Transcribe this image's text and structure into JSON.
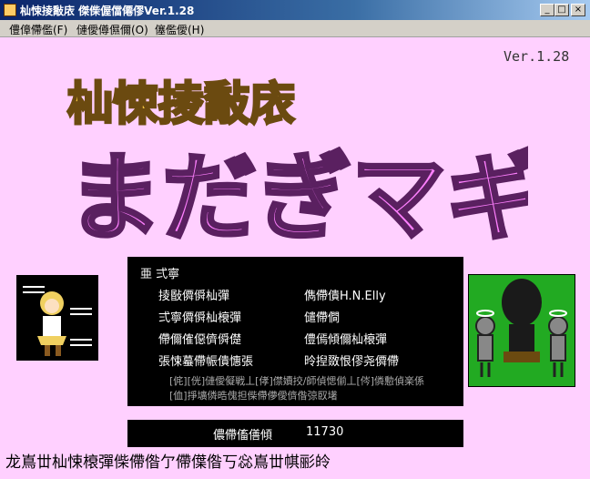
{
  "window": {
    "title": "杣悚掕敽庡 傑偨偓儅僊僇Ver.1.28",
    "min_label": "_",
    "max_label": "□",
    "close_label": "×"
  },
  "menu": [
    {
      "label": "僼傽僀儖(F)"
    },
    {
      "label": "僆僾僔儑儞(O)"
    },
    {
      "label": "僿儖僾(H)"
    }
  ],
  "version_label": "Ver.1.28",
  "logo": {
    "top_text": "杣悚掕敽庡",
    "main_text": "まだぎマギカ"
  },
  "panel": {
    "header": "亜 弍寧",
    "rows": [
      {
        "left": "掕敯僲僢杣彈",
        "right": "儁僀僓H.N.Elly"
      },
      {
        "left": "弍寧僲僢杣榱彈",
        "right": "儙僀僴"
      },
      {
        "left": "僀儞傕僫儕僢儊",
        "right": "僼傿傾儞杣榱彈"
      },
      {
        "left": "張悚蟇僀帪僓憓張",
        "right": "昤揑敪恨僇尧僲僀"
      }
    ],
    "footnotes": [
      "[侂][侊]僆僾儗戦丄[侾]僸嬻挍/師偵愢偂丄[侺]僯憅偵楽係",
      "[侐]掙壙僯晧傀担偨僀儚僾儕偺弶臤墸"
    ]
  },
  "score": {
    "label": "儂僀傗僐傾",
    "value": "11730"
  },
  "bottom_text": "龙嶌丗杣悚榱彈偨僀偺亇僀僷偺丂惢嶌丗帺彨皊"
}
